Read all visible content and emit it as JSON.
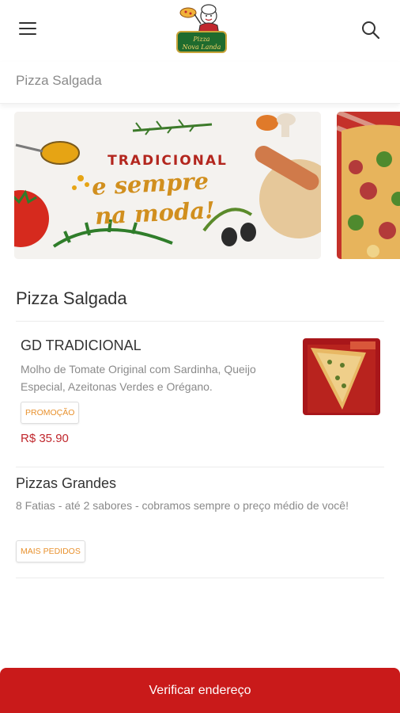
{
  "header": {
    "menu_icon": "hamburger-menu-icon",
    "search_icon": "search-icon",
    "logo": {
      "name": "Pizza Nova Landa logo",
      "line1": "Pizza",
      "line2": "Nova Landa"
    }
  },
  "breadcrumb": {
    "label": "Pizza Salgada"
  },
  "banners": [
    {
      "line1": "TRADICIONAL",
      "line2": "e sempre",
      "line3": "na moda!"
    },
    {
      "description_icon": "pizza-photo"
    }
  ],
  "section": {
    "title": "Pizza Salgada",
    "items": [
      {
        "name": "GD TRADICIONAL",
        "description": "Molho de Tomate Original com Sardinha, Queijo Especial, Azeitonas Verdes e Orégano.",
        "badge": "PROMOÇÃO",
        "price": "R$ 35.90"
      },
      {
        "name": "Pizzas Grandes",
        "description": "8 Fatias - até 2 sabores - cobramos sempre o preço médio de você!",
        "badge": "MAIS PEDIDOS"
      }
    ]
  },
  "cta": {
    "label": "Verificar endereço"
  },
  "colors": {
    "brand_red": "#c91a1a",
    "badge_orange": "#e8912d",
    "price_red": "#c0272d"
  }
}
